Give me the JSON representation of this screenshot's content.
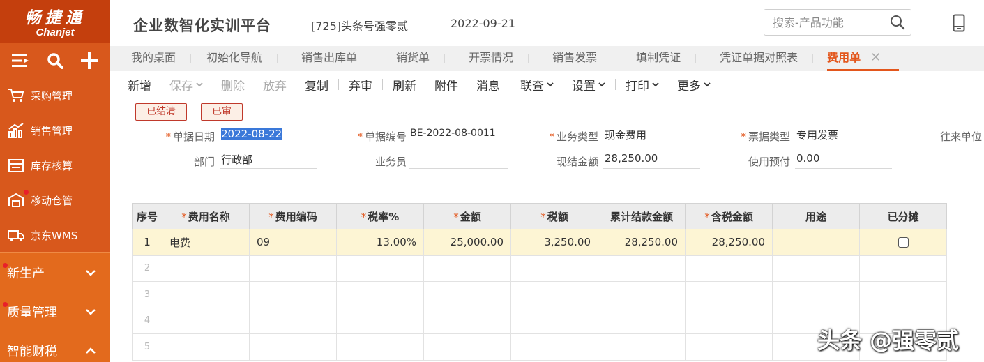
{
  "sidebar": {
    "logo_cn": "畅捷通",
    "logo_en": "Chanjet",
    "items": [
      {
        "label": "采购管理"
      },
      {
        "label": "销售管理"
      },
      {
        "label": "库存核算"
      },
      {
        "label": "移动仓管"
      },
      {
        "label": "京东WMS"
      }
    ],
    "groups": [
      {
        "label": "新生产"
      },
      {
        "label": "质量管理"
      },
      {
        "label": "智能财税"
      }
    ]
  },
  "header": {
    "platform": "企业数智化实训平台",
    "account": "[725]头条号强零贰",
    "date": "2022-09-21",
    "search_placeholder": "搜索-产品功能"
  },
  "tabs": [
    {
      "label": "我的桌面"
    },
    {
      "label": "初始化导航"
    },
    {
      "label": "销售出库单"
    },
    {
      "label": "销货单"
    },
    {
      "label": "开票情况"
    },
    {
      "label": "销售发票"
    },
    {
      "label": "填制凭证"
    },
    {
      "label": "凭证单据对照表"
    },
    {
      "label": "费用单"
    }
  ],
  "toolbar": {
    "add": "新增",
    "save": "保存",
    "delete": "删除",
    "discard": "放弃",
    "copy": "复制",
    "unaudit": "弃审",
    "refresh": "刷新",
    "attach": "附件",
    "message": "消息",
    "link": "联查",
    "settings": "设置",
    "print": "打印",
    "more": "更多"
  },
  "status": {
    "cleared": "已结清",
    "audited": "已审"
  },
  "form": {
    "date_label": "单据日期",
    "date": "2022-08-22",
    "code_label": "单据编号",
    "code": "BE-2022-08-0011",
    "biz_label": "业务类型",
    "biz": "现金费用",
    "invoice_label": "票据类型",
    "invoice": "专用发票",
    "partner_label": "往来单位",
    "dept_label": "部门",
    "dept": "行政部",
    "clerk_label": "业务员",
    "clerk": "",
    "cash_label": "现结金额",
    "cash": "28,250.00",
    "prepay_label": "使用预付",
    "prepay": "0.00"
  },
  "table": {
    "headers": {
      "idx": "序号",
      "name": "费用名称",
      "code": "费用编码",
      "rate": "税率%",
      "amount": "金额",
      "tax": "税额",
      "settled": "累计结款金额",
      "gross": "含税金额",
      "purpose": "用途",
      "split": "已分摊"
    },
    "rows": [
      {
        "idx": "1",
        "name": "电费",
        "code": "09",
        "rate": "13.00%",
        "amount": "25,000.00",
        "tax": "3,250.00",
        "settled": "28,250.00",
        "gross": "28,250.00",
        "purpose": ""
      },
      {
        "idx": "2"
      },
      {
        "idx": "3"
      },
      {
        "idx": "4"
      },
      {
        "idx": "5"
      }
    ]
  },
  "watermark": "头条 @强零贰"
}
